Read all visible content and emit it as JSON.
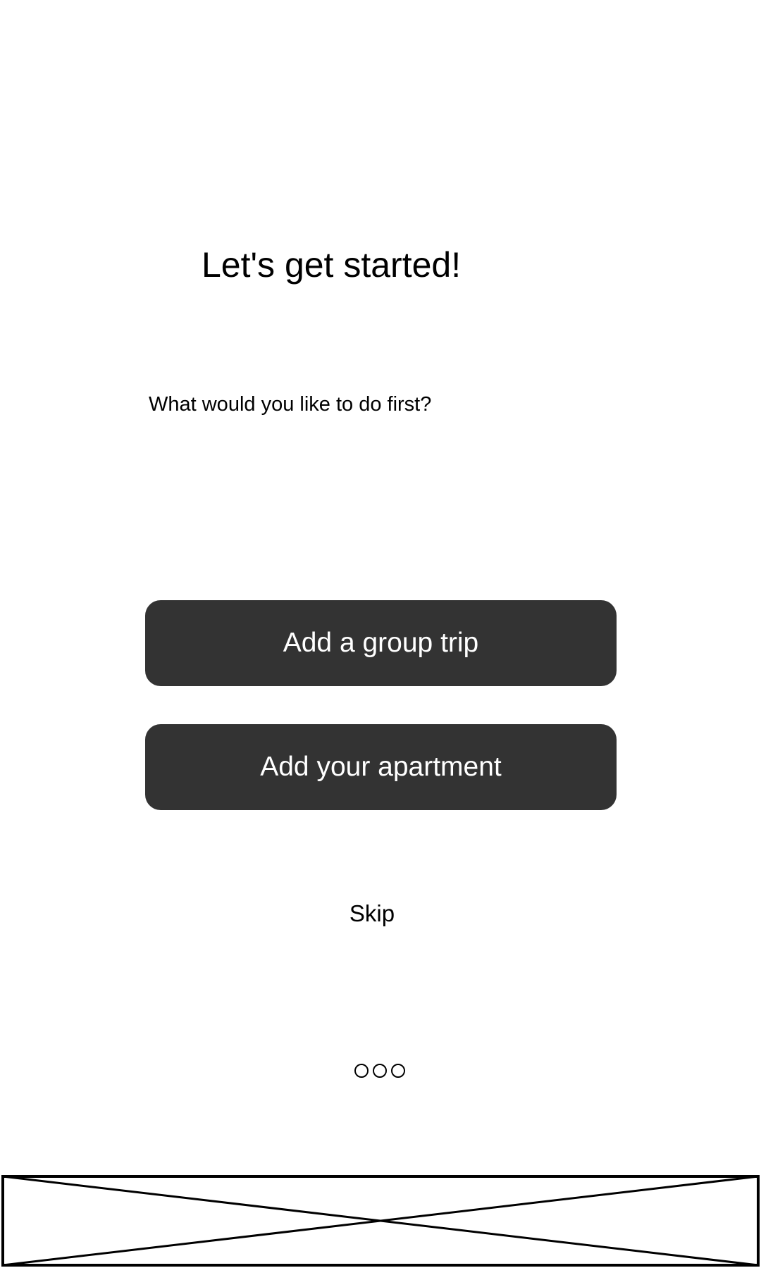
{
  "onboarding": {
    "title": "Let's get started!",
    "subtitle": "What would you like to do first?",
    "buttons": [
      {
        "label": "Add a group trip"
      },
      {
        "label": "Add your apartment"
      }
    ],
    "skip_label": "Skip",
    "page_indicator": {
      "total_pages": 3
    }
  },
  "colors": {
    "button_background": "#333333",
    "button_text": "#ffffff",
    "text": "#000000",
    "background": "#ffffff"
  },
  "icons": {
    "bottom_placeholder": "image-placeholder-icon"
  }
}
